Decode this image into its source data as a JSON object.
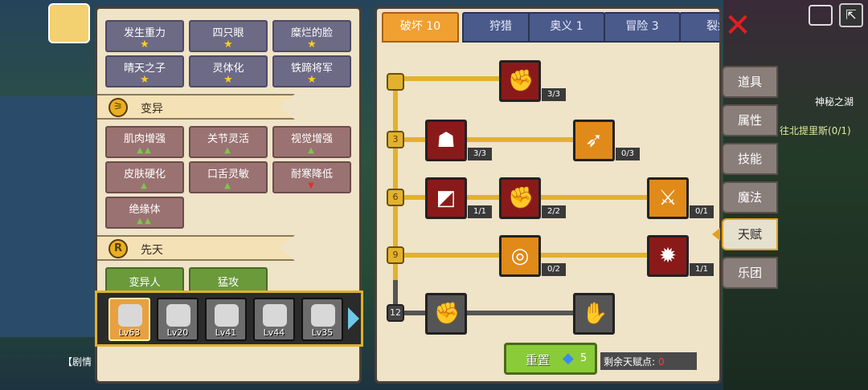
{
  "mutations_top": [
    {
      "label": "发生重力",
      "mark": "star"
    },
    {
      "label": "四只眼",
      "mark": "star"
    },
    {
      "label": "糜烂的脸",
      "mark": "star"
    },
    {
      "label": "晴天之子",
      "mark": "star"
    },
    {
      "label": "灵体化",
      "mark": "star"
    },
    {
      "label": "铁蹄将军",
      "mark": "star"
    }
  ],
  "section_mutation": "变异",
  "mutation_cells": [
    {
      "label": "肌肉增强",
      "marks": "▲▲"
    },
    {
      "label": "关节灵活",
      "marks": "▲"
    },
    {
      "label": "视觉增强",
      "marks": "▲"
    },
    {
      "label": "皮肤硬化",
      "marks": "▲"
    },
    {
      "label": "口舌灵敏",
      "marks": "▲"
    },
    {
      "label": "耐寒降低",
      "marks": "▼"
    },
    {
      "label": "绝缘体",
      "marks": "▲▲"
    }
  ],
  "section_innate": "先天",
  "innate_icon": "R",
  "innate_cells": [
    {
      "label": "变异人"
    },
    {
      "label": "猛攻"
    }
  ],
  "characters": [
    {
      "level": "Lv63"
    },
    {
      "level": "Lv20"
    },
    {
      "level": "Lv41"
    },
    {
      "level": "Lv44"
    },
    {
      "level": "Lv35"
    }
  ],
  "tabs": [
    "破坏 10",
    "狩猎",
    "奥义 1",
    "冒险 3",
    "裂痕"
  ],
  "tiers": [
    "3",
    "6",
    "9",
    "12"
  ],
  "nodes": {
    "n1": "3/3",
    "n2": "3/3",
    "n3": "0/3",
    "n4": "1/1",
    "n5": "2/2",
    "n6": "0/1",
    "n7": "0/2",
    "n8": "1/1"
  },
  "reset_label": "重置",
  "reset_cost": "5",
  "remaining_label": "剩余天赋点:",
  "remaining_value": "0",
  "side_menu": [
    "道具",
    "属性",
    "技能",
    "魔法",
    "天赋",
    "乐团"
  ],
  "bg_text": {
    "lake": "神秘之湖",
    "quest": "往北提里斯(0/1)",
    "story": "【剧情"
  },
  "colors": {
    "accent": "#e2b22e",
    "active_tab": "#f0a030"
  }
}
